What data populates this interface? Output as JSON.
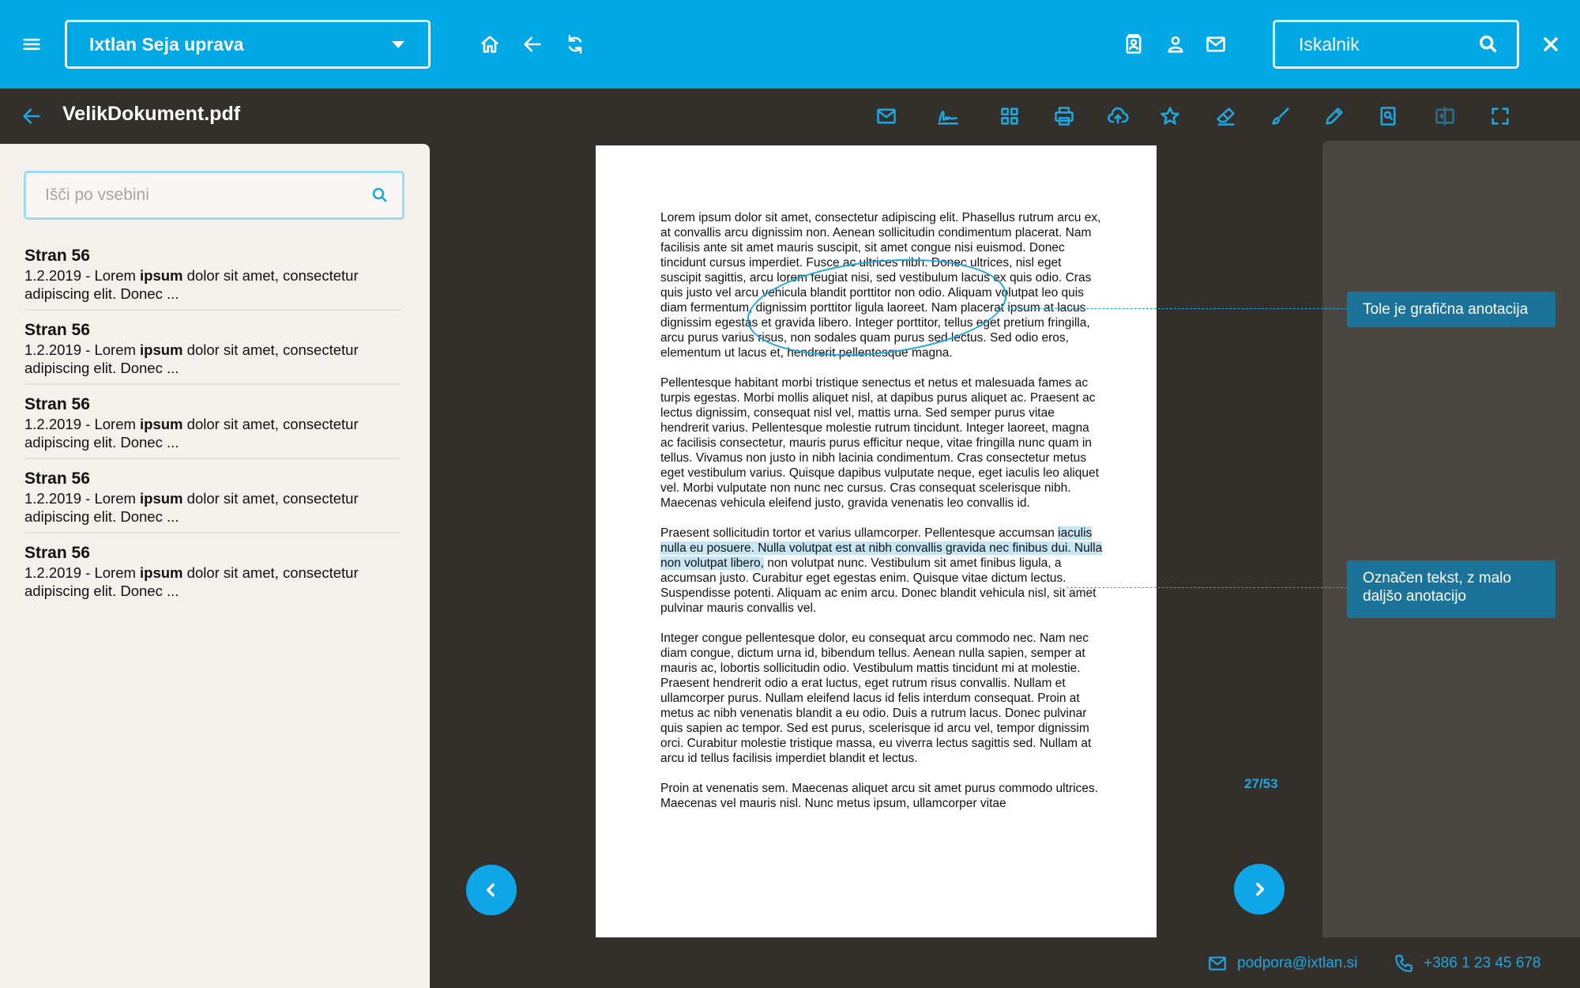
{
  "app": {
    "selected_module": "Ixtlan Seja uprava",
    "search_label": "Iskalnik"
  },
  "document": {
    "title": "VelikDokument.pdf"
  },
  "sidebar": {
    "search_placeholder": "Išči po vsebini",
    "results": [
      {
        "title": "Stran 56",
        "prefix": "1.2.2019 - Lorem ",
        "match": "ipsum",
        "suffix": " dolor sit amet, consectetur adipiscing elit. Donec ..."
      },
      {
        "title": "Stran 56",
        "prefix": "1.2.2019 - Lorem ",
        "match": "ipsum",
        "suffix": " dolor sit amet, consectetur adipiscing elit. Donec ..."
      },
      {
        "title": "Stran 56",
        "prefix": "1.2.2019 - Lorem ",
        "match": "ipsum",
        "suffix": " dolor sit amet, consectetur adipiscing elit. Donec ..."
      },
      {
        "title": "Stran 56",
        "prefix": "1.2.2019 - Lorem ",
        "match": "ipsum",
        "suffix": " dolor sit amet, consectetur adipiscing elit. Donec ..."
      },
      {
        "title": "Stran 56",
        "prefix": "1.2.2019 - Lorem ",
        "match": "ipsum",
        "suffix": " dolor sit amet, consectetur adipiscing elit. Donec ..."
      }
    ]
  },
  "page_content": {
    "para1": "Lorem ipsum dolor sit amet, consectetur adipiscing elit. Phasellus rutrum arcu ex, at convallis arcu dignissim non. Aenean sollicitudin condimentum placerat. Nam facilisis ante sit amet mauris suscipit, sit amet congue nisi euismod. Donec tincidunt cursus imperdiet. Fusce ac ultrices nibh. Donec ultrices, nisl eget suscipit sagittis, arcu lorem feugiat nisi, sed vestibulum lacus ex quis odio. Cras quis justo vel arcu vehicula blandit porttitor non odio. Aliquam volutpat leo quis diam fermentum, dignissim porttitor ligula laoreet. Nam placerat ipsum at lacus dignissim egestas et gravida libero. Integer porttitor, tellus eget pretium fringilla, arcu purus varius risus, non sodales quam purus sed lectus. Sed odio eros, elementum ut lacus et, hendrerit pellentesque magna.",
    "para2": "Pellentesque habitant morbi tristique senectus et netus et malesuada fames ac turpis egestas. Morbi mollis aliquet nisl, at dapibus purus aliquet ac. Praesent ac lectus dignissim, consequat nisl vel, mattis urna. Sed semper purus vitae hendrerit varius. Pellentesque molestie rutrum tincidunt. Integer laoreet, magna ac facilisis consectetur, mauris purus efficitur neque, vitae fringilla nunc quam in tellus. Vivamus non justo in nibh lacinia condimentum. Cras consectetur metus eget vestibulum varius. Quisque dapibus vulputate neque, eget iaculis leo aliquet vel. Morbi vulputate non nunc nec cursus. Cras consequat scelerisque nibh. Maecenas vehicula eleifend justo, gravida venenatis leo convallis id.",
    "para3_pre": "Praesent sollicitudin tortor et varius ullamcorper. Pellentesque accumsan ",
    "para3_highlight": "iaculis nulla eu posuere. Nulla volutpat est at nibh convallis gravida nec finibus dui. Nulla non volutpat libero,",
    "para3_post": " non volutpat nunc. Vestibulum sit amet finibus ligula, a accumsan justo. Curabitur eget egestas enim. Quisque vitae dictum lectus. Suspendisse potenti. Aliquam ac enim arcu. Donec blandit vehicula nisl, sit amet pulvinar mauris convallis vel.",
    "para4": "Integer congue pellentesque dolor, eu consequat arcu commodo nec. Nam nec diam congue, dictum urna id, bibendum tellus. Aenean nulla sapien, semper at mauris ac, lobortis sollicitudin odio. Vestibulum mattis tincidunt mi at molestie. Praesent hendrerit odio a erat luctus, eget rutrum risus convallis. Nullam et ullamcorper purus. Nullam eleifend lacus id felis interdum consequat. Proin at metus ac nibh venenatis blandit a eu odio. Duis a rutrum lacus. Donec pulvinar quis sapien ac tempor. Sed est purus, scelerisque id arcu vel, tempor dignissim orci. Curabitur molestie tristique massa, eu viverra lectus sagittis sed. Nullam at arcu id tellus facilisis imperdiet blandit et lectus.",
    "para5": "Proin at venenatis sem. Maecenas aliquet arcu sit amet purus commodo ultrices. Maecenas vel mauris nisl. Nunc metus ipsum, ullamcorper vitae"
  },
  "annotations": [
    {
      "text": "Tole je grafična anotacija"
    },
    {
      "text": "Označen tekst, z malo daljšo anotacijo"
    }
  ],
  "pagination": {
    "indicator": "27/53"
  },
  "footer": {
    "email": "podpora@ixtlan.si",
    "phone": "+386 1 23 45 678"
  },
  "colors": {
    "topbar": "#00a9e6",
    "accent": "#1ea6e0",
    "dark_bg": "#33302c",
    "annotation_bg": "#1c739a",
    "highlight": "#c7e6f5"
  },
  "icons": {
    "topbar": [
      "menu-icon",
      "home-icon",
      "back-arrow-icon",
      "refresh-icon",
      "contacts-icon",
      "user-icon",
      "mail-icon",
      "search-icon",
      "close-icon"
    ],
    "toolbar": [
      "mail-icon",
      "signature-icon",
      "grid-icon",
      "print-icon",
      "cloud-upload-icon",
      "star-icon",
      "eraser-icon",
      "brush-icon",
      "pencil-icon",
      "document-search-icon",
      "compare-icon",
      "fullscreen-icon"
    ]
  }
}
